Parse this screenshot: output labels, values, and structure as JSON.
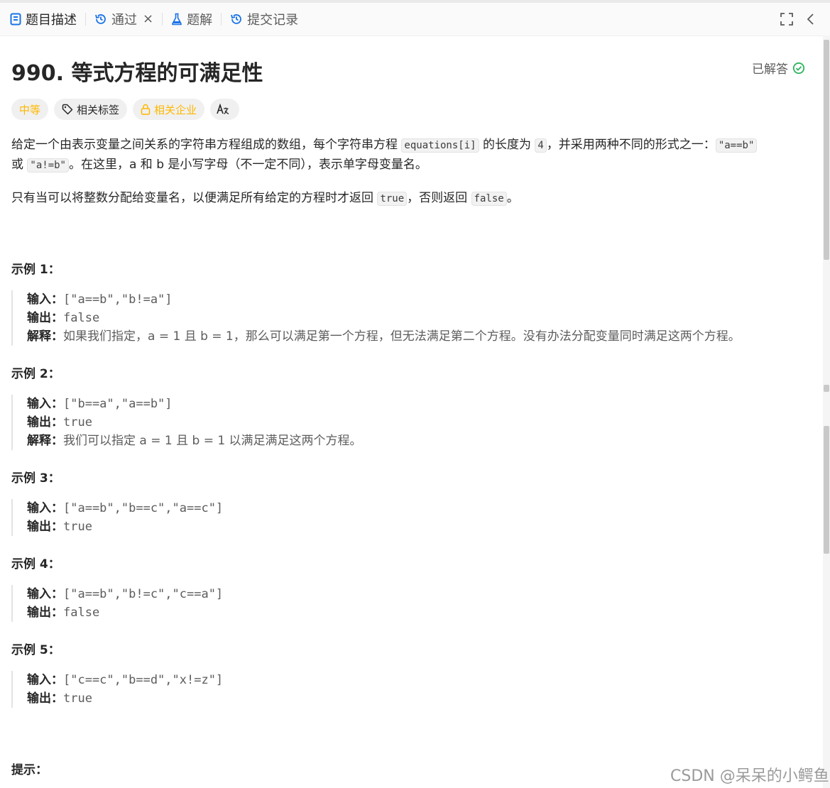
{
  "tabs": [
    {
      "label": "题目描述",
      "icon": "description-icon"
    },
    {
      "label": "通过",
      "icon": "history-icon"
    },
    {
      "label": "题解",
      "icon": "flask-icon"
    },
    {
      "label": "提交记录",
      "icon": "history-icon"
    }
  ],
  "tab_close_label": "×",
  "problem": {
    "title": "990. 等式方程的可满足性",
    "status": "已解答",
    "tags": {
      "difficulty": "中等",
      "related_tags": "相关标签",
      "related_companies": "相关企业",
      "translate_icon": "translate-icon"
    },
    "description": {
      "p1_a": "给定一个由表示变量之间关系的字符串方程组成的数组，每个字符串方程 ",
      "p1_code1": "equations[i]",
      "p1_b": " 的长度为 ",
      "p1_code2": "4",
      "p1_c": "，并采用两种不同的形式之一：",
      "p1_code3": "\"a==b\"",
      "p1_d": " 或 ",
      "p1_code4": "\"a!=b\"",
      "p1_e": "。在这里，a 和 b 是小写字母（不一定不同），表示单字母变量名。",
      "p2_a": "只有当可以将整数分配给变量名，以便满足所有给定的方程时才返回 ",
      "p2_code1": "true",
      "p2_b": "，否则返回 ",
      "p2_code2": "false",
      "p2_c": "。"
    },
    "labels": {
      "input": "输入：",
      "output": "输出：",
      "explanation": "解释："
    },
    "examples": [
      {
        "title": "示例 1：",
        "input": "[\"a==b\",\"b!=a\"]",
        "output": "false",
        "explanation": "如果我们指定，a = 1 且 b = 1，那么可以满足第一个方程，但无法满足第二个方程。没有办法分配变量同时满足这两个方程。"
      },
      {
        "title": "示例 2：",
        "input": "[\"b==a\",\"a==b\"]",
        "output": "true",
        "explanation": "我们可以指定 a = 1 且 b = 1 以满足满足这两个方程。"
      },
      {
        "title": "示例 3：",
        "input": "[\"a==b\",\"b==c\",\"a==c\"]",
        "output": "true"
      },
      {
        "title": "示例 4：",
        "input": "[\"a==b\",\"b!=c\",\"c==a\"]",
        "output": "false"
      },
      {
        "title": "示例 5：",
        "input": "[\"c==c\",\"b==d\",\"x!=z\"]",
        "output": "true"
      }
    ],
    "hint_title": "提示："
  },
  "watermark": "CSDN @呆呆的小鳄鱼",
  "colors": {
    "accent_success": "#2db55d",
    "difficulty_medium": "#ffb800"
  }
}
